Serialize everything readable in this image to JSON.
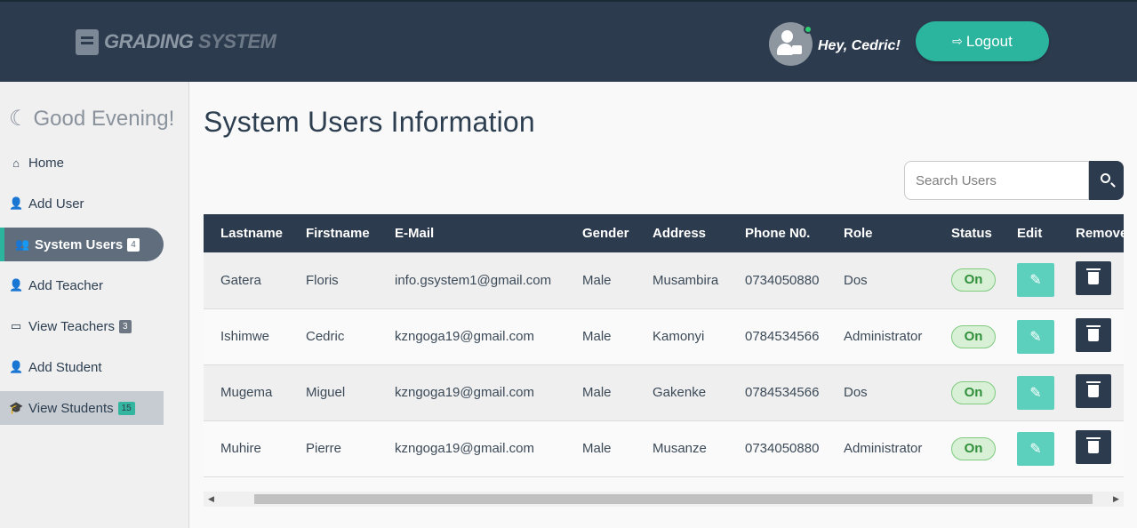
{
  "header": {
    "brand_part1": "GRADING",
    "brand_part2": "SYSTEM",
    "greeting": "Hey, Cedric!",
    "logout_label": "Logout"
  },
  "sidebar": {
    "greeting": "Good Evening!",
    "items": [
      {
        "label": "Home",
        "icon": "home-icon"
      },
      {
        "label": "Add User",
        "icon": "add-user-icon"
      },
      {
        "label": "System Users",
        "icon": "users-icon",
        "badge": "4"
      },
      {
        "label": "Add Teacher",
        "icon": "add-teacher-icon"
      },
      {
        "label": "View Teachers",
        "icon": "teacher-icon",
        "badge": "3"
      },
      {
        "label": "Add Student",
        "icon": "add-student-icon"
      },
      {
        "label": "View Students",
        "icon": "student-icon",
        "badge": "15"
      }
    ]
  },
  "main": {
    "title": "System Users Information",
    "search_placeholder": "Search Users",
    "columns": [
      "Lastname",
      "Firstname",
      "E-Mail",
      "Gender",
      "Address",
      "Phone N0.",
      "Role",
      "Status",
      "Edit",
      "Remove"
    ],
    "rows": [
      {
        "lastname": "Gatera",
        "firstname": "Floris",
        "email": "info.gsystem1@gmail.com",
        "gender": "Male",
        "address": "Musambira",
        "phone": "0734050880",
        "role": "Dos",
        "status": "On"
      },
      {
        "lastname": "Ishimwe",
        "firstname": "Cedric",
        "email": "kzngoga19@gmail.com",
        "gender": "Male",
        "address": "Kamonyi",
        "phone": "0784534566",
        "role": "Administrator",
        "status": "On"
      },
      {
        "lastname": "Mugema",
        "firstname": "Miguel",
        "email": "kzngoga19@gmail.com",
        "gender": "Male",
        "address": "Gakenke",
        "phone": "0784534566",
        "role": "Dos",
        "status": "On"
      },
      {
        "lastname": "Muhire",
        "firstname": "Pierre",
        "email": "kzngoga19@gmail.com",
        "gender": "Male",
        "address": "Musanze",
        "phone": "0734050880",
        "role": "Administrator",
        "status": "On"
      }
    ]
  },
  "colors": {
    "header_bg": "#2d3b4e",
    "accent": "#2bb59f",
    "status_on": "#2f8f3a"
  }
}
